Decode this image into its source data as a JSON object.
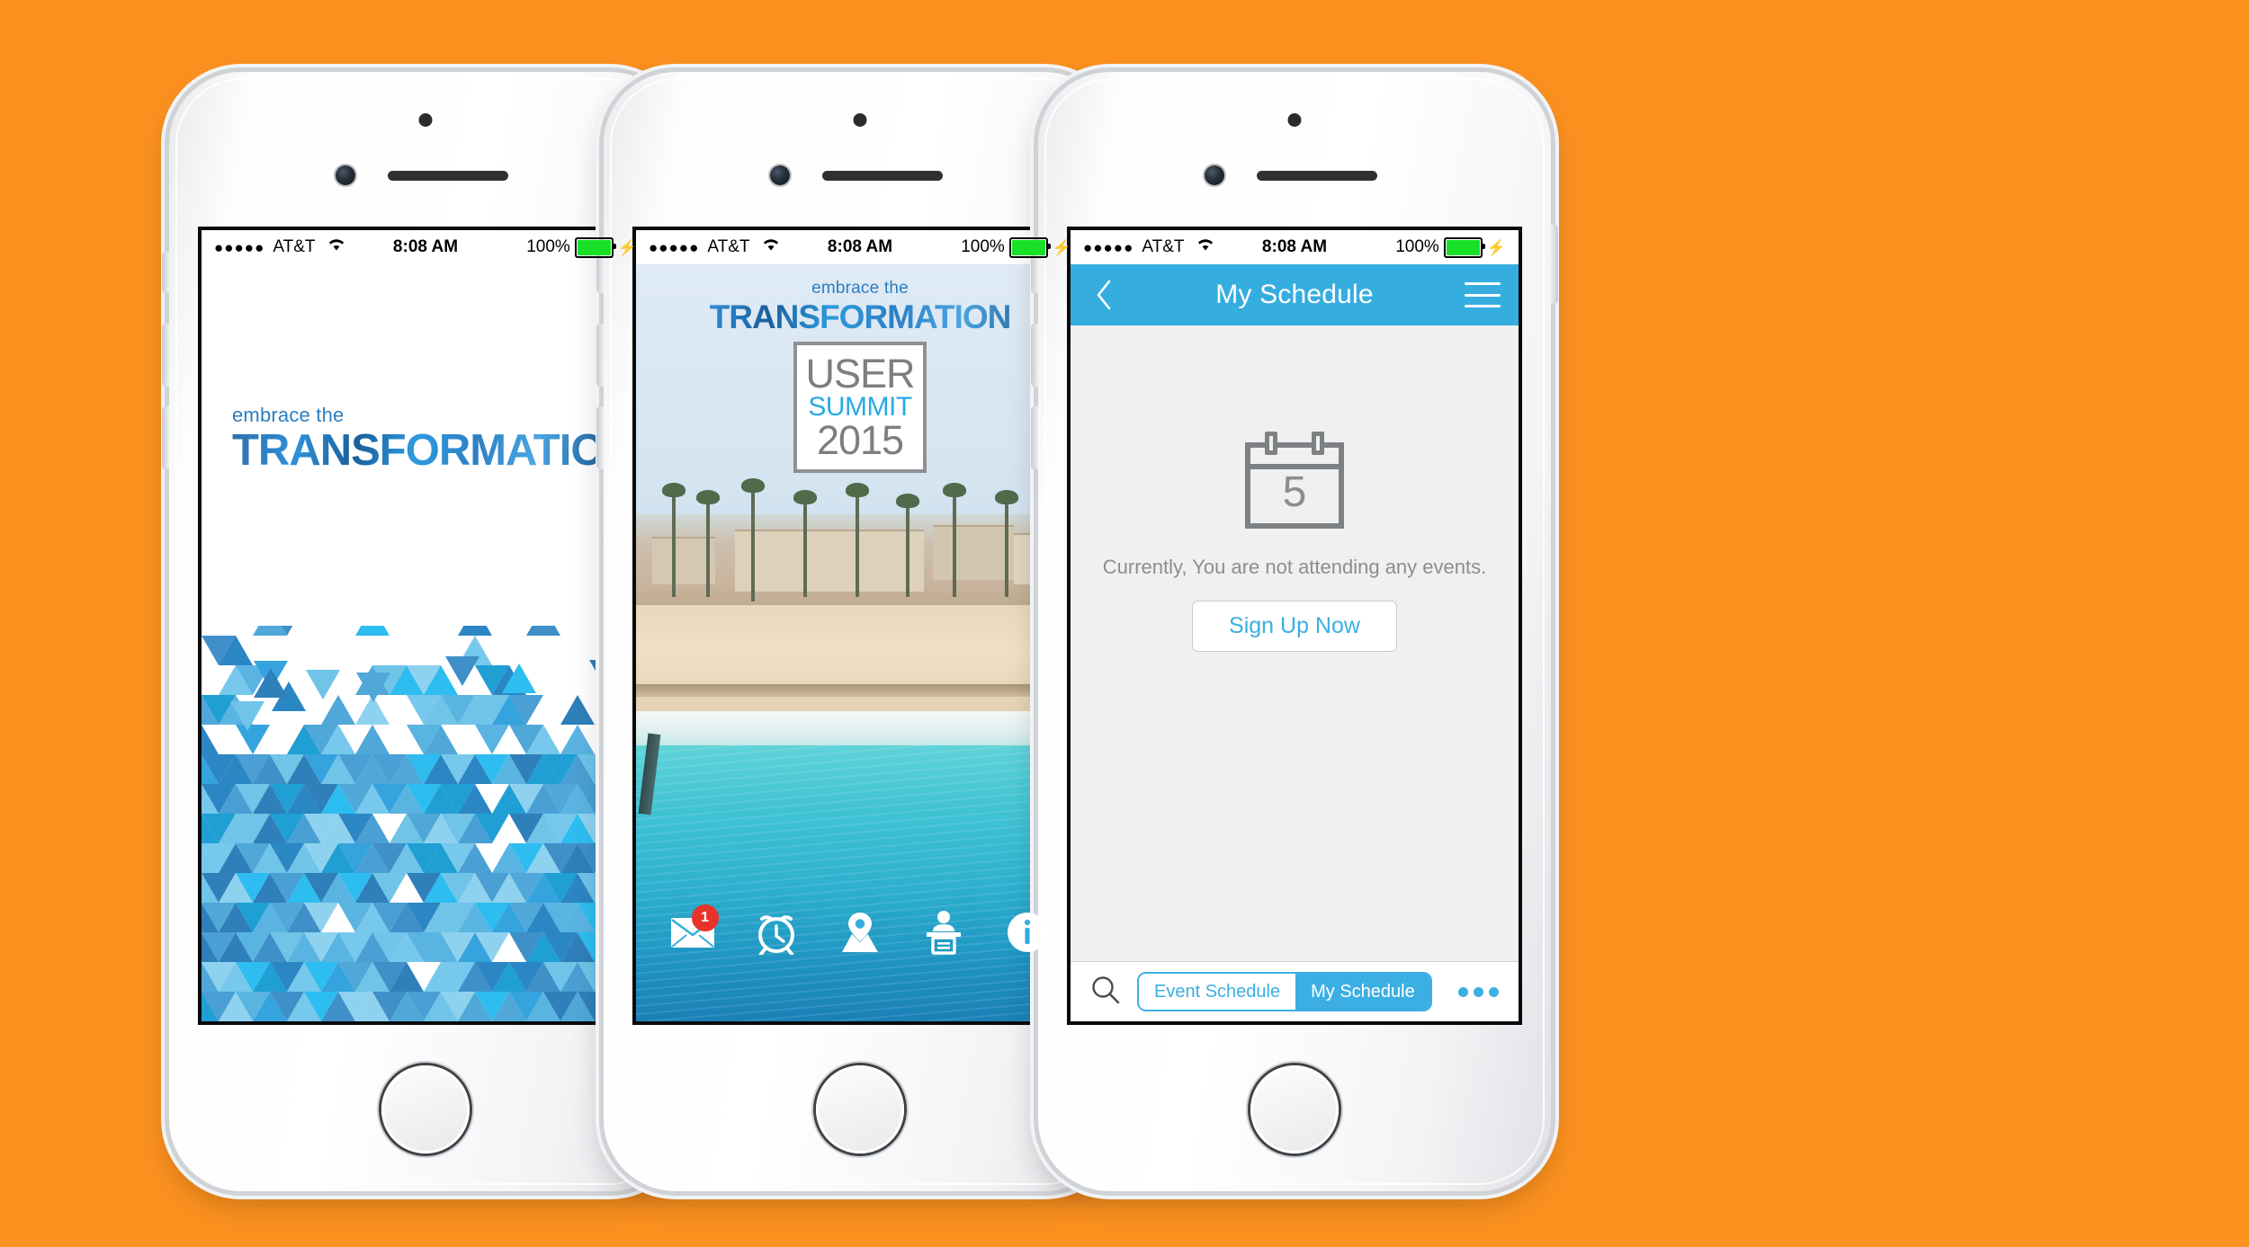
{
  "background_color": "#FC911F",
  "brand": {
    "accent_blue": "#3BAFE3",
    "nav_blue": "#36ADDF",
    "logo_small": "embrace the",
    "logo_big": "TRANSFORMATION"
  },
  "status_bar": {
    "signal_dots": "●●●●●",
    "carrier": "AT&T",
    "time": "8:08 AM",
    "battery_percent": "100%",
    "charging": "⚡"
  },
  "phones": [
    {
      "name": "splash-screen",
      "screen_type": "splash",
      "logo_small": "embrace the",
      "logo_big": "TRANSFORMATION"
    },
    {
      "name": "home-screen",
      "screen_type": "home",
      "logo_small": "embrace the",
      "logo_big": "TRANSFORMATION",
      "summit_logo": {
        "line1": "USER",
        "line2": "SUMMIT",
        "line3": "2015",
        "line1_color": "#7c7f82",
        "line2_color": "#29aae2",
        "line3_color": "#7c7f82"
      },
      "icon_bar": [
        {
          "icon": "envelope-icon",
          "label": "Messages",
          "badge": "1"
        },
        {
          "icon": "alarm-clock-icon",
          "label": "Schedule",
          "badge": ""
        },
        {
          "icon": "map-pin-icon",
          "label": "Maps",
          "badge": ""
        },
        {
          "icon": "speaker-podium-icon",
          "label": "Speakers",
          "badge": ""
        },
        {
          "icon": "info-circle-icon",
          "label": "Info",
          "badge": ""
        }
      ]
    },
    {
      "name": "my-schedule-screen",
      "screen_type": "my-schedule",
      "nav": {
        "back_icon": "chevron-left-icon",
        "title": "My Schedule",
        "menu_icon": "hamburger-menu-icon"
      },
      "empty_state": {
        "calendar_day": "5",
        "message": "Currently, You are not attending any events.",
        "button_label": "Sign Up Now"
      },
      "tab_bar": {
        "search_icon": "search-icon",
        "segments": [
          {
            "label": "Event Schedule",
            "selected": false
          },
          {
            "label": "My Schedule",
            "selected": true
          }
        ],
        "more_icon": "more-dots-icon"
      }
    }
  ]
}
